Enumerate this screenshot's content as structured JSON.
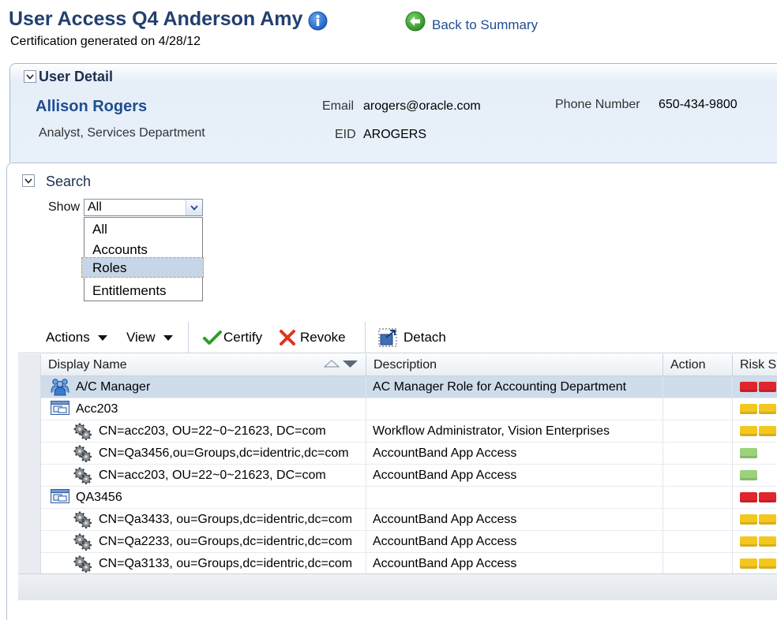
{
  "header": {
    "title": "User Access Q4 Anderson Amy",
    "subtitle": "Certification generated on 4/28/12",
    "back_label": "Back to Summary"
  },
  "user_detail": {
    "section_title": "User Detail",
    "name": "Allison Rogers",
    "job": "Analyst, Services Department",
    "email_label": "Email",
    "email": "arogers@oracle.com",
    "eid_label": "EID",
    "eid": "AROGERS",
    "phone_label": "Phone Number",
    "phone": "650-434-9800"
  },
  "search": {
    "section_title": "Search",
    "show_label": "Show",
    "selected_value": "All",
    "options": [
      "All",
      "Accounts",
      "Roles",
      "Entitlements"
    ],
    "highlighted_option": "Roles"
  },
  "toolbar": {
    "actions_label": "Actions",
    "view_label": "View",
    "certify_label": "Certify",
    "revoke_label": "Revoke",
    "detach_label": "Detach"
  },
  "table": {
    "columns": [
      "Display Name",
      "Description",
      "Action",
      "Risk Su"
    ],
    "rows": [
      {
        "icon": "role",
        "indent": 0,
        "name": "A/C Manager",
        "description": "AC Manager Role for Accounting Department",
        "risk": "red",
        "selected": true
      },
      {
        "icon": "account",
        "indent": 0,
        "name": "Acc203",
        "description": "",
        "risk": "yellow"
      },
      {
        "icon": "entitlement",
        "indent": 1,
        "name": "CN=acc203, OU=22~0~21623, DC=com",
        "description": "Workflow Administrator, Vision Enterprises",
        "risk": "yellow"
      },
      {
        "icon": "entitlement",
        "indent": 1,
        "name": "CN=Qa3456,ou=Groups,dc=identric,dc=com",
        "description": "AccountBand App Access",
        "risk": "green"
      },
      {
        "icon": "entitlement",
        "indent": 1,
        "name": "CN=acc203, OU=22~0~21623, DC=com",
        "description": "AccountBand App Access",
        "risk": "green"
      },
      {
        "icon": "account",
        "indent": 0,
        "name": "QA3456",
        "description": "",
        "risk": "red"
      },
      {
        "icon": "entitlement",
        "indent": 1,
        "name": "CN=Qa3433, ou=Groups,dc=identric,dc=com",
        "description": "AccountBand App Access",
        "risk": "yellow"
      },
      {
        "icon": "entitlement",
        "indent": 1,
        "name": "CN=Qa2233, ou=Groups,dc=identric,dc=com",
        "description": "AccountBand App Access",
        "risk": "yellow"
      },
      {
        "icon": "entitlement",
        "indent": 1,
        "name": "CN=Qa3133, ou=Groups,dc=identric,dc=com",
        "description": "AccountBand App Access",
        "risk": "yellow"
      }
    ]
  },
  "colors": {
    "title": "#223f6e",
    "link": "#1f4d8f",
    "risk_red": "#e0252b",
    "risk_yellow": "#f3c71e",
    "risk_green": "#9bd27a"
  }
}
